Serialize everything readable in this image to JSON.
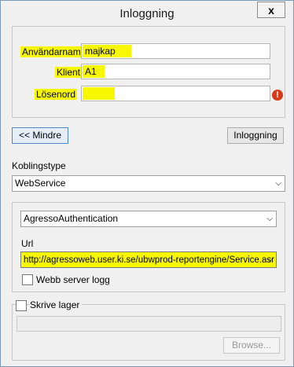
{
  "window": {
    "title": "Inloggning",
    "close_label": "x"
  },
  "login": {
    "username_label": "Användarnamn",
    "username_value": "majkap",
    "client_label": "Klient",
    "client_value": "A1",
    "password_label": "Lösenord",
    "password_value": "",
    "error_icon_text": "!"
  },
  "buttons": {
    "less_label": "<< Mindre",
    "login_label": "Inloggning"
  },
  "connection": {
    "type_label": "Koblingstype",
    "type_value": "WebService",
    "auth_value": "AgressoAuthentication",
    "url_label": "Url",
    "url_value": "http://agressoweb.user.ki.se/ubwprod-reportengine/Service.asr",
    "webb_log_label": "Webb server logg",
    "webb_log_checked": false
  },
  "storage": {
    "write_label": "Skrive lager",
    "write_checked": false,
    "path_value": "",
    "browse_label": "Browse..."
  }
}
